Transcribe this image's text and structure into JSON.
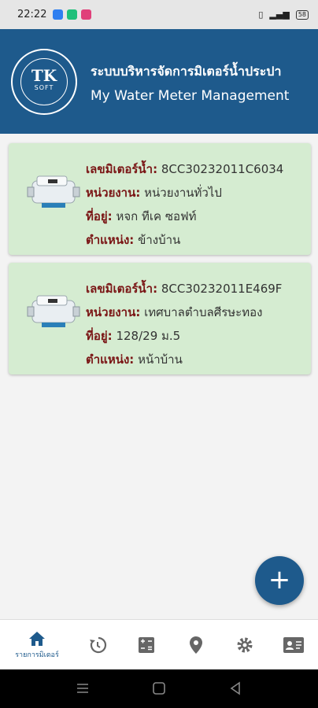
{
  "status_bar": {
    "time": "22:22",
    "battery": "58",
    "notification_colors": [
      "#2f7ff0",
      "#1ec07a",
      "#e0407a"
    ]
  },
  "header": {
    "logo_text": "TK",
    "logo_sub": "SOFT",
    "title_th": "ระบบบริหารจัดการมิเตอร์น้ำประปา",
    "title_en": "My Water Meter Management",
    "color": "#1e5a8c"
  },
  "meters": [
    {
      "meter_label": "เลขมิเตอร์น้ำ:",
      "meter_no": "8CC30232011C6034",
      "agency_label": "หน่วยงาน:",
      "agency": "หน่วยงานทั่วไป",
      "address_label": "ที่อยู่:",
      "address": "หจก ทีเค ซอฟท์",
      "position_label": "ตำแหน่ง:",
      "position": "ข้างบ้าน"
    },
    {
      "meter_label": "เลขมิเตอร์น้ำ:",
      "meter_no": "8CC30232011E469F",
      "agency_label": "หน่วยงาน:",
      "agency": "เทศบาลตำบลศีรษะทอง",
      "address_label": "ที่อยู่:",
      "address": "128/29 ม.5",
      "position_label": "ตำแหน่ง:",
      "position": "หน้าบ้าน"
    }
  ],
  "fab": {
    "label": "+"
  },
  "bottom_nav": {
    "items": [
      {
        "icon": "home-icon",
        "label": "รายการมิเตอร์",
        "active": true
      },
      {
        "icon": "history-icon"
      },
      {
        "icon": "calculator-icon"
      },
      {
        "icon": "location-pin-icon"
      },
      {
        "icon": "gear-icon"
      },
      {
        "icon": "contact-card-icon"
      }
    ]
  }
}
